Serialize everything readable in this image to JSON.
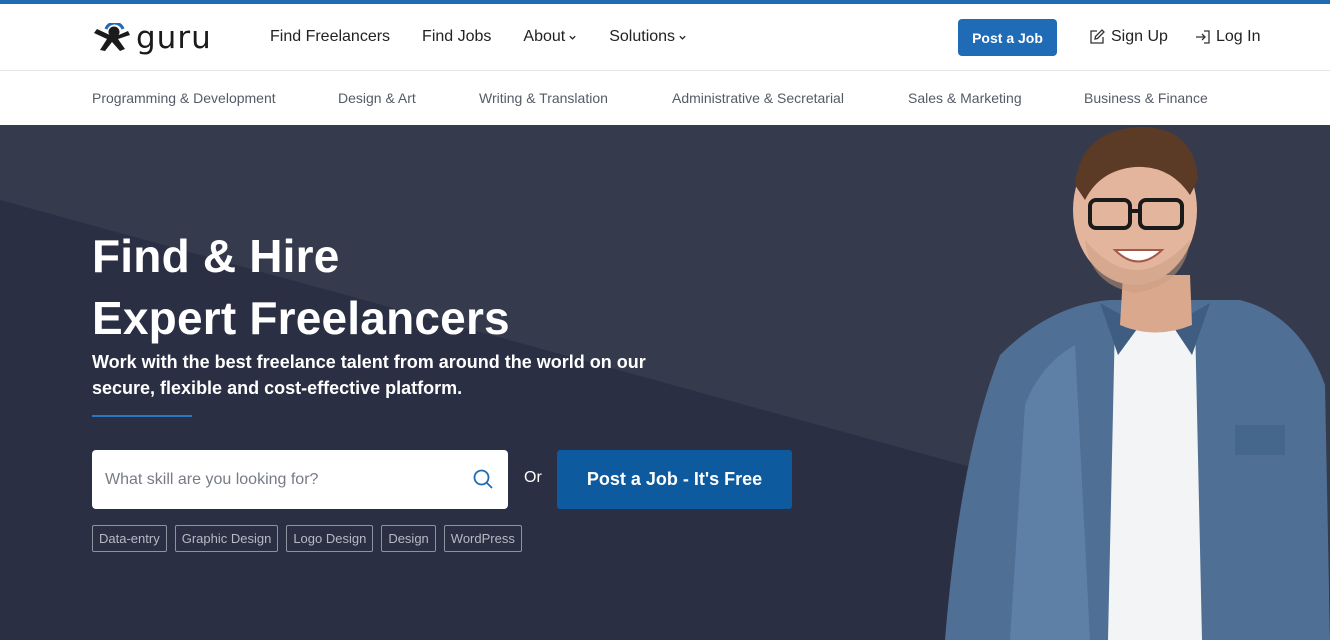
{
  "brand": {
    "name": "guru"
  },
  "nav": {
    "items": [
      {
        "label": "Find Freelancers",
        "has_dropdown": false
      },
      {
        "label": "Find Jobs",
        "has_dropdown": false
      },
      {
        "label": "About",
        "has_dropdown": true
      },
      {
        "label": "Solutions",
        "has_dropdown": true
      }
    ],
    "post_job": "Post a Job",
    "sign_up": "Sign Up",
    "log_in": "Log In"
  },
  "categories": [
    "Programming & Development",
    "Design & Art",
    "Writing & Translation",
    "Administrative & Secretarial",
    "Sales & Marketing",
    "Business & Finance"
  ],
  "hero": {
    "title_line1": "Find & Hire",
    "title_line2": "Expert Freelancers",
    "subtitle": "Work with the best freelance talent from around the world on our secure, flexible and cost-effective platform.",
    "search_placeholder": "What skill are you looking for?",
    "or_label": "Or",
    "cta_label": "Post a Job - It's Free",
    "tags": [
      "Data-entry",
      "Graphic Design",
      "Logo Design",
      "Design",
      "WordPress"
    ]
  },
  "colors": {
    "accent": "#1f6bb6",
    "cta": "#0e5a9e",
    "hero_bg": "#353a4d",
    "hero_bg_dark": "#2a2f44"
  }
}
